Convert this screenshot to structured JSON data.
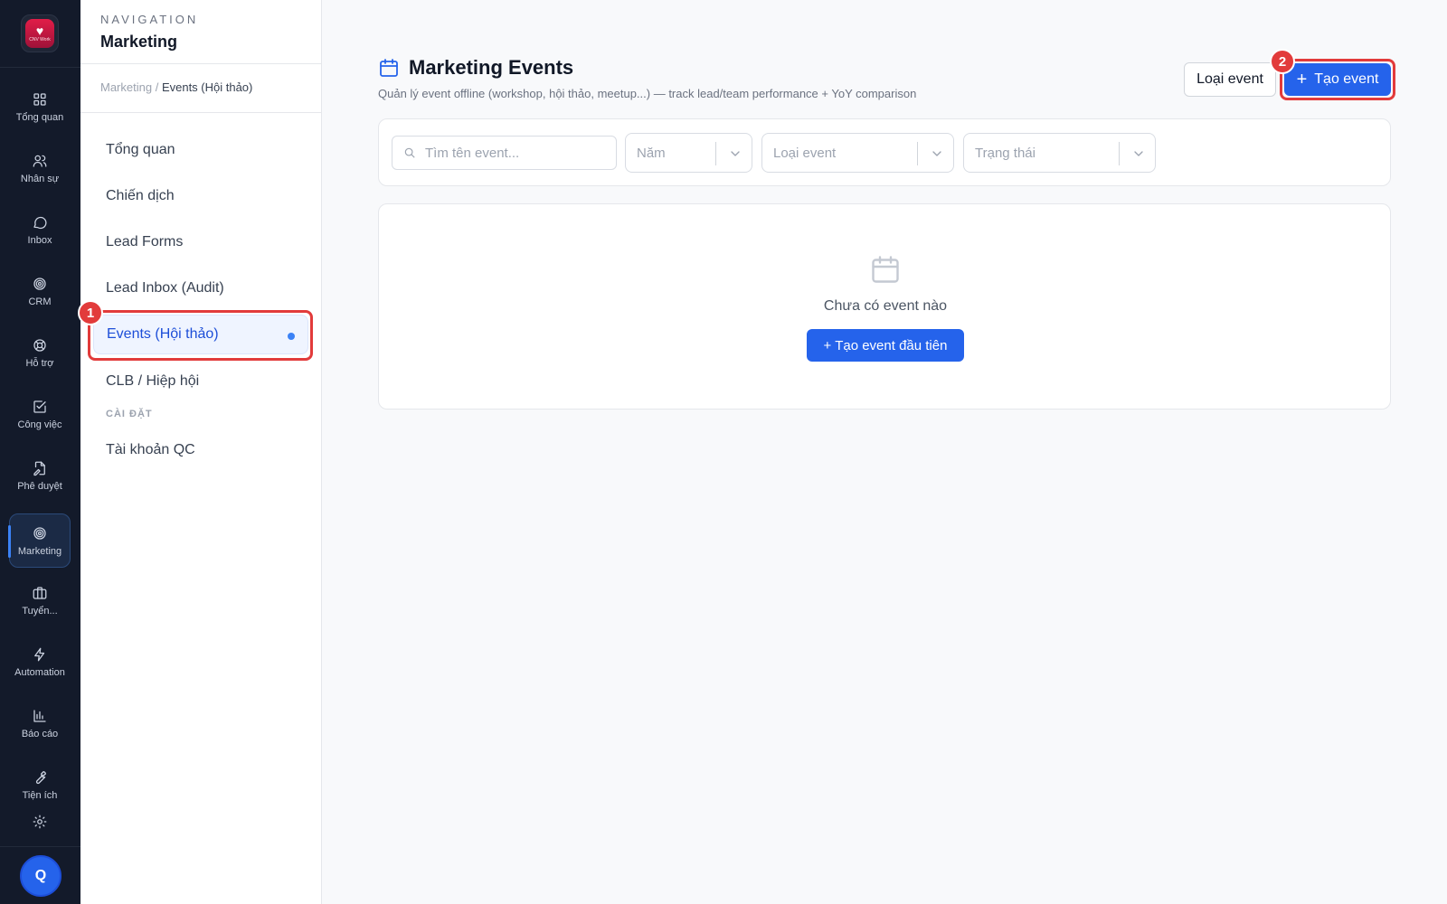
{
  "app": {
    "logo_text": "CNV Work",
    "avatar_initial": "Q"
  },
  "rail": {
    "items": [
      {
        "label": "Tổng quan",
        "icon": "grid-icon"
      },
      {
        "label": "Nhân sự",
        "icon": "users-icon"
      },
      {
        "label": "Inbox",
        "icon": "chat-icon"
      },
      {
        "label": "CRM",
        "icon": "target-icon"
      },
      {
        "label": "Hỗ trợ",
        "icon": "lifebuoy-icon"
      },
      {
        "label": "Công việc",
        "icon": "checkbox-icon"
      },
      {
        "label": "Phê duyệt",
        "icon": "document-sign-icon"
      },
      {
        "label": "Marketing",
        "icon": "target-icon",
        "active": true
      },
      {
        "label": "Tuyển...",
        "icon": "briefcase-icon"
      },
      {
        "label": "Automation",
        "icon": "lightning-icon"
      },
      {
        "label": "Báo cáo",
        "icon": "bar-chart-icon"
      },
      {
        "label": "Tiện ích",
        "icon": "wrench-icon"
      },
      {
        "label": "",
        "icon": "gear-icon"
      }
    ]
  },
  "subnav": {
    "kicker": "NAVIGATION",
    "title": "Marketing",
    "breadcrumb_root": "Marketing /",
    "breadcrumb_current": "Events (Hội thảo)",
    "items": [
      {
        "label": "Tổng quan"
      },
      {
        "label": "Chiến dịch"
      },
      {
        "label": "Lead Forms"
      },
      {
        "label": "Lead Inbox (Audit)"
      },
      {
        "label": "Events (Hội thảo)",
        "active": true
      },
      {
        "label": "CLB / Hiệp hội"
      }
    ],
    "section_settings": "CÀI ĐẶT",
    "settings_items": [
      {
        "label": "Tài khoản QC"
      }
    ]
  },
  "annotations": {
    "badge_1": "1",
    "badge_2": "2",
    "highlight_color": "#e23b3b"
  },
  "main": {
    "title": "Marketing Events",
    "subtitle": "Quản lý event offline (workshop, hội thảo, meetup...) — track lead/team performance + YoY comparison",
    "btn_event_type": "Loại event",
    "btn_create": "Tạo event",
    "filters": {
      "search_placeholder": "Tìm tên event...",
      "year_placeholder": "Năm",
      "type_placeholder": "Loại event",
      "status_placeholder": "Trạng thái"
    },
    "empty": {
      "text": "Chưa có event nào",
      "button": "+ Tạo event đầu tiên"
    }
  },
  "colors": {
    "accent": "#2563eb",
    "rail_bg": "#131a2a"
  }
}
